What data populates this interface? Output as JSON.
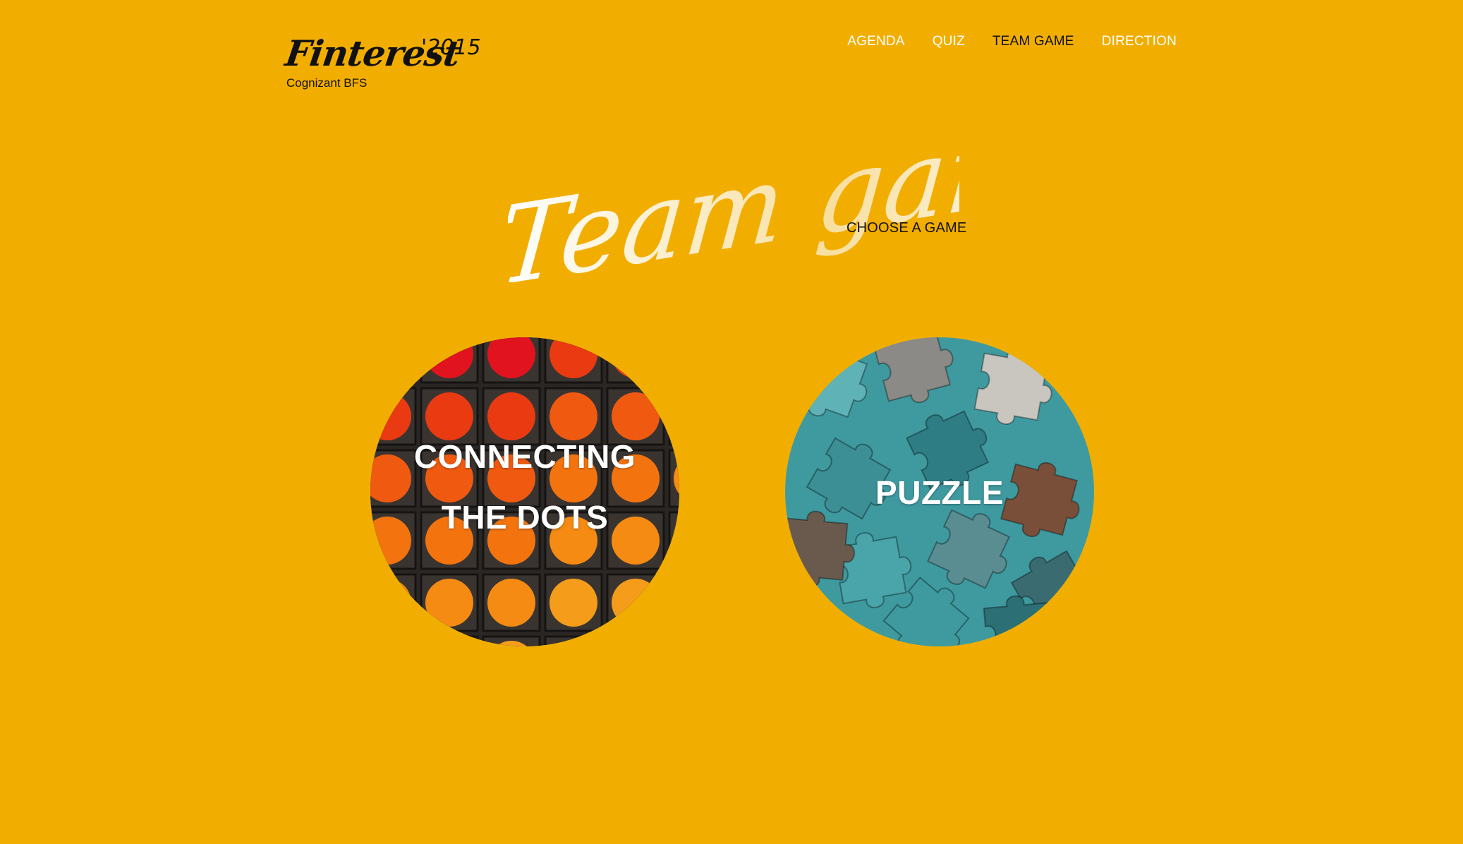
{
  "brand": {
    "logo": "Finterest",
    "year": "'2015",
    "subtitle": "Cognizant BFS"
  },
  "nav": {
    "items": [
      {
        "label": "AGENDA",
        "active": false
      },
      {
        "label": "QUIZ",
        "active": false
      },
      {
        "label": "TEAM GAME",
        "active": true
      },
      {
        "label": "DIRECTION",
        "active": false
      }
    ]
  },
  "hero": {
    "title": "Team game",
    "subtitle": "CHOOSE A GAME"
  },
  "games": [
    {
      "line1": "CONNECTING",
      "line2": "THE DOTS"
    },
    {
      "line1": "PUZZLE"
    }
  ],
  "colors": {
    "background": "#F2AE00",
    "nav_text": "#FFFFFF",
    "nav_active": "#111111",
    "title_gradient_start": "#FFFFFF",
    "title_gradient_end": "#F7D78A"
  }
}
